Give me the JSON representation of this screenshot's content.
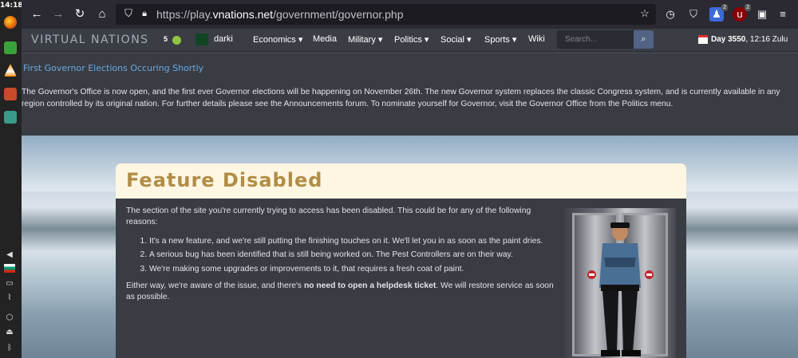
{
  "os": {
    "clock": "14:18",
    "tray_icons": [
      "volume-icon",
      "flag-icon",
      "screen-icon",
      "paperclip-icon",
      "package-icon",
      "eject-icon",
      "bluetooth-icon"
    ]
  },
  "browser": {
    "url_prefix": "https://play.",
    "url_domain": "vnations.net",
    "url_path": "/government/governor.php",
    "ext_badge_1": "2",
    "ext_badge_2": "2"
  },
  "site": {
    "logo": "VIRTUAL NATIONS",
    "online_count": "5",
    "nation_name": "darki",
    "nav": [
      "Economics ▾",
      "Media",
      "Military ▾",
      "Politics ▾",
      "Social ▾",
      "Sports ▾",
      "Wiki"
    ],
    "search_placeholder": "Search...",
    "day_label": "Day 3550",
    "time": ", 12:16 Zulu"
  },
  "announcement": {
    "title": "First Governor Elections Occuring Shortly",
    "body": "The Governor's Office is now open, and the first ever Governor elections will be happening on November 26th. The new Governor system replaces the classic Congress system, and is currently available in any region controlled by its original nation. For further details please see the Announcements forum. To nominate yourself for Governor, visit the Governor Office from the Politics menu."
  },
  "feature": {
    "title": "Feature Disabled",
    "intro": "The section of the site you're currently trying to access has been disabled. This could be for any of the following reasons:",
    "reasons": [
      "It's a new feature, and we're still putting the finishing touches on it. We'll let you in as soon as the paint dries.",
      "A serious bug has been identified that is still being worked on. The Pest Controllers are on their way.",
      "We're making some upgrades or improvements to it, that requires a fresh coat of paint."
    ],
    "foot_before": "Either way, we're aware of the issue, and there's ",
    "foot_bold": "no need to open a helpdesk ticket",
    "foot_after": ". We will restore service as soon as possible."
  }
}
